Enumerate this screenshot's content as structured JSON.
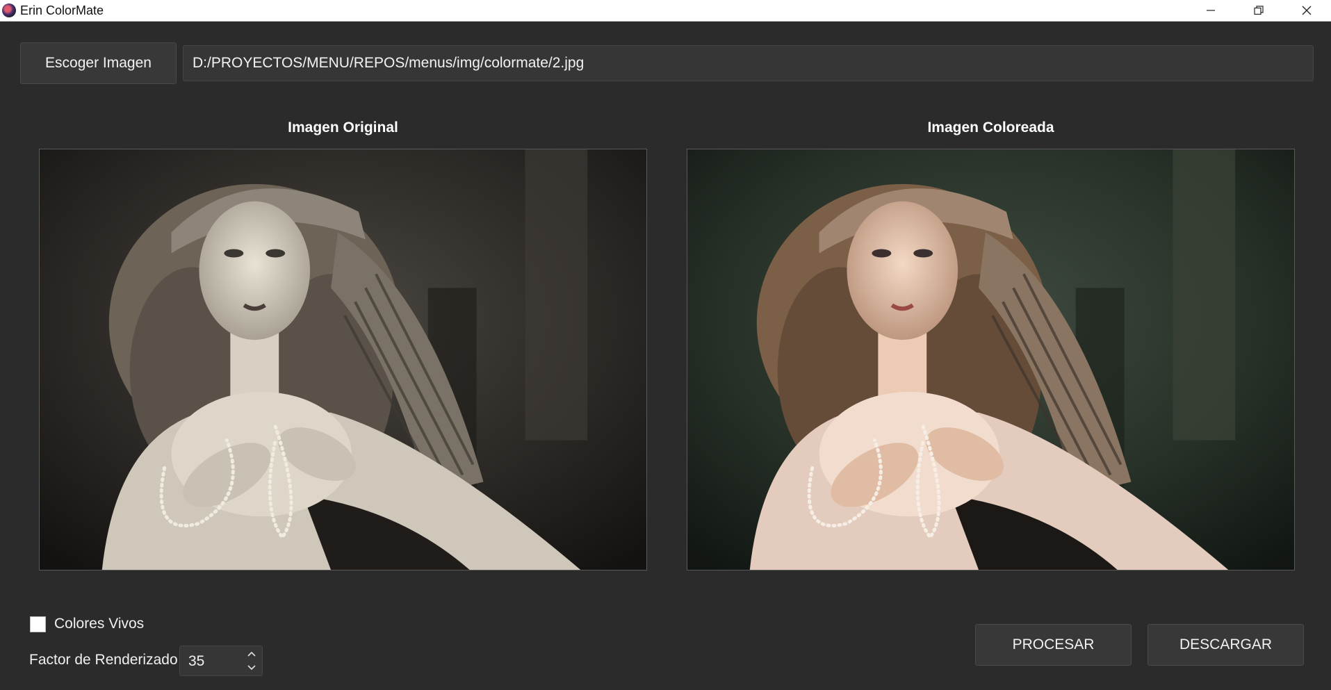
{
  "window": {
    "title": "Erin ColorMate",
    "controls": {
      "minimize_icon": "minimize-icon",
      "maximize_icon": "restore-icon",
      "close_icon": "close-icon"
    }
  },
  "toolbar": {
    "choose_label": "Escoger Imagen",
    "path_value": "D:/PROYECTOS/MENU/REPOS/menus/img/colormate/2.jpg"
  },
  "panels": {
    "original_title": "Imagen Original",
    "colored_title": "Imagen Coloreada"
  },
  "options": {
    "vivid_label": "Colores Vivos",
    "vivid_checked": false,
    "factor_label": "Factor de Renderizado",
    "factor_value": "35"
  },
  "actions": {
    "process_label": "PROCESAR",
    "download_label": "DESCARGAR"
  },
  "colors": {
    "background": "#2b2b2b",
    "button": "#383838",
    "field": "#363636",
    "text": "#f0f0f0"
  }
}
